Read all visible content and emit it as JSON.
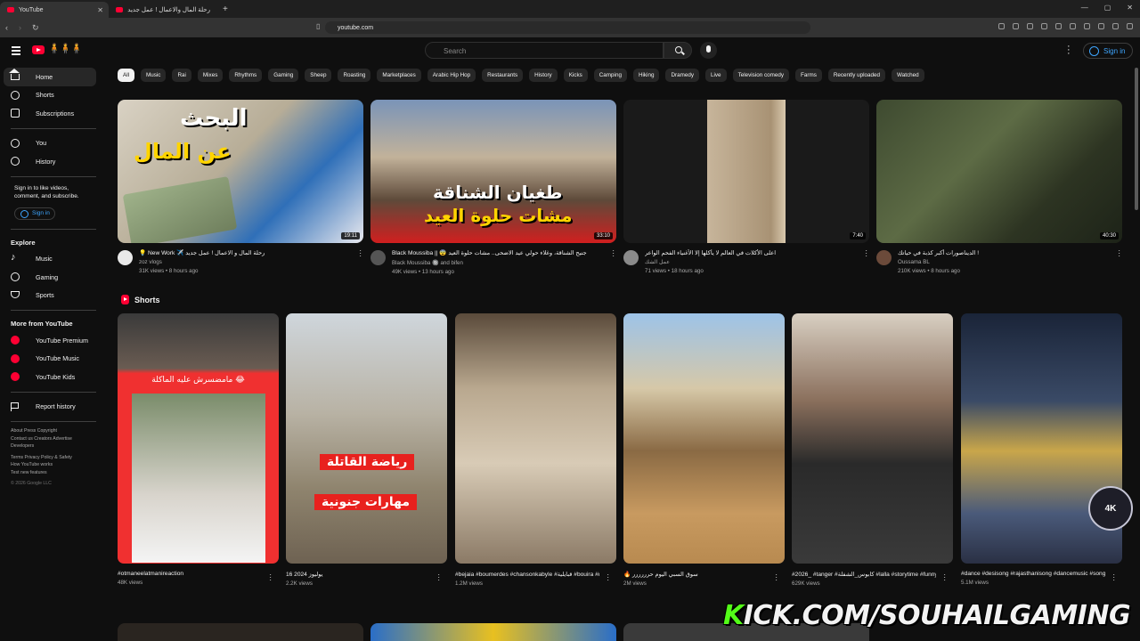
{
  "browser": {
    "tabs": [
      {
        "title": "YouTube"
      },
      {
        "title": "رحلة المال والاعمال ! عمل جديد 🫣"
      }
    ],
    "url": "youtube.com"
  },
  "header": {
    "search_placeholder": "Search",
    "sign_in": "Sign in"
  },
  "sidebar": {
    "main": [
      {
        "label": "Home",
        "icon": "home-icon"
      },
      {
        "label": "Shorts",
        "icon": "shorts-icon"
      },
      {
        "label": "Subscriptions",
        "icon": "subscriptions-icon"
      }
    ],
    "you": [
      {
        "label": "You",
        "icon": "account-icon"
      },
      {
        "label": "History",
        "icon": "history-icon"
      }
    ],
    "signin_text": "Sign in to like videos, comment, and subscribe.",
    "signin_button": "Sign in",
    "explore_title": "Explore",
    "explore": [
      {
        "label": "Music",
        "icon": "music-icon"
      },
      {
        "label": "Gaming",
        "icon": "gaming-icon"
      },
      {
        "label": "Sports",
        "icon": "trophy-icon"
      }
    ],
    "more_title": "More from YouTube",
    "more": [
      {
        "label": "YouTube Premium"
      },
      {
        "label": "YouTube Music"
      },
      {
        "label": "YouTube Kids"
      }
    ],
    "report": "Report history",
    "footer1": "About  Press  Copyright",
    "footer2": "Contact us  Creators  Advertise",
    "footer3": "Developers",
    "footer4": "Terms  Privacy  Policy & Safety",
    "footer5": "How YouTube works",
    "footer6": "Test new features",
    "copyright": "© 2026 Google LLC"
  },
  "chips": [
    "All",
    "Music",
    "Rai",
    "Mixes",
    "Rhythms",
    "Gaming",
    "Sheep",
    "Roasting",
    "Marketplaces",
    "Arabic Hip Hop",
    "Restaurants",
    "History",
    "Kicks",
    "Camping",
    "Hiking",
    "Dramedy",
    "Live",
    "Television comedy",
    "Farms",
    "Recently uploaded",
    "Watched"
  ],
  "videos": [
    {
      "title": "💡 New Work ✈️ رحلة المال و الاعمال ! عمل جديد",
      "channel": "zoz vlogs",
      "meta": "31K views • 8 hours ago",
      "duration": "19:11",
      "thumb_text1": "البحث",
      "thumb_text2": "عن المال"
    },
    {
      "title": "Black Moussiba || 😨 جنيح الشناقة، وغلاء حولي عيد الاضحى.. مشات حلوة العيد",
      "channel": "Black Moussiba 🔘 and bifen",
      "meta": "49K views • 13 hours ago",
      "duration": "33:10",
      "thumb_text1": "طغيان الشناقة",
      "thumb_text2": "مشات حلوة العيد"
    },
    {
      "title": "اعلى الأكلات في العالم لا يأكلها إلا الأغنياء الفحم الواعر",
      "channel": "عمل الشك",
      "meta": "71 views • 18 hours ago",
      "duration": "7:40"
    },
    {
      "title": "الديناصورات أكبر كذبة في حياتك !",
      "channel": "Oussama BL",
      "meta": "210K views • 8 hours ago",
      "duration": "40:30"
    }
  ],
  "shorts_title": "Shorts",
  "shorts": [
    {
      "title": "#otmaneelatmanireaction",
      "views": "48K views",
      "overlay": "😂 مامضسرش عليه الماكلة"
    },
    {
      "title": "16 2024 يوليوز",
      "views": "2.2K views",
      "overlay1": "رياضة القاتلة",
      "overlay2": "مهارات جنونية"
    },
    {
      "title": "#bejaia #boumerdes #chansonkabyle #قبايلية #bouira #dancekabyle #تيزي_وزو #بجاية",
      "views": "1.2M views"
    },
    {
      "title": "🔥 سوق السبي اليوم حرررررر",
      "views": "2M views"
    },
    {
      "title": "#2026_ #tanger #كابوس_الشفلة #lalla #storytime #funny #الرومة_لالة",
      "views": "629K views"
    },
    {
      "title": "#dance #desisong #rajasthanisong #dancemusic #song #dj ...",
      "views": "5.1M views"
    }
  ],
  "watermark": {
    "k": "K",
    "rest": "ICK.COM/SOUHAILGAMING",
    "badge": "4K"
  },
  "colors": {
    "accent": "#ff0033",
    "link": "#3ea6ff",
    "background": "#0f0f0f",
    "kick": "#53fc18"
  }
}
